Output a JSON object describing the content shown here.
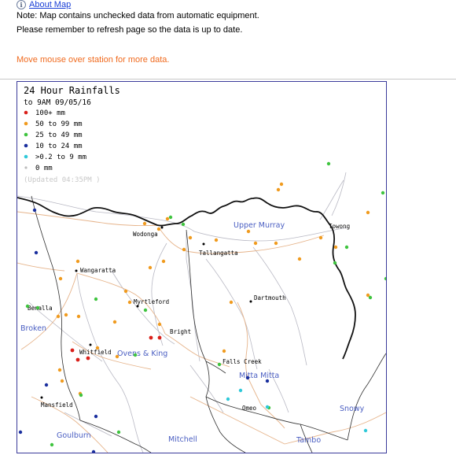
{
  "header": {
    "about_link": "About Map",
    "note_line1": "Note: Map contains unchecked data from automatic equipment.",
    "note_line2": "Please remember to refresh page so the data is up to date.",
    "hover_hint": "Move mouse over station for more data."
  },
  "map": {
    "title": "24 Hour Rainfalls",
    "subtitle": "to 9AM 09/05/16",
    "updated": "(Updated 04:35PM  )",
    "legend": [
      {
        "label": "100+ mm",
        "color": "#d9201a"
      },
      {
        "label": "50  to 99 mm",
        "color": "#f09b1f"
      },
      {
        "label": "25  to 49 mm",
        "color": "#3fc43f"
      },
      {
        "label": "10  to 24 mm",
        "color": "#1a2f9e"
      },
      {
        "label": ">0.2 to 9 mm",
        "color": "#2fc9d9"
      },
      {
        "label": "0 mm",
        "color": "#bdbdbd"
      }
    ],
    "towns": {
      "wodonga": "Wodonga",
      "tallangatta": "Tallangatta",
      "towong": "Towong",
      "wangaratta": "Wangaratta",
      "myrtleford": "Myrtleford",
      "dartmouth": "Dartmouth",
      "benalla": "Benalla",
      "bright": "Bright",
      "whitfield": "Whitfield",
      "falls_creek": "Falls Creek",
      "omeo": "Omeo",
      "mansfield": "Mansfield"
    },
    "districts": {
      "upper_murray": "Upper Murray",
      "broken": "Broken",
      "ovens_king": "Ovens & King",
      "mitta_mitta": "Mitta Mitta",
      "snowy": "Snowy",
      "goulburn": "Goulburn",
      "mitchell": "Mitchell",
      "tambo": "Tambo"
    }
  }
}
